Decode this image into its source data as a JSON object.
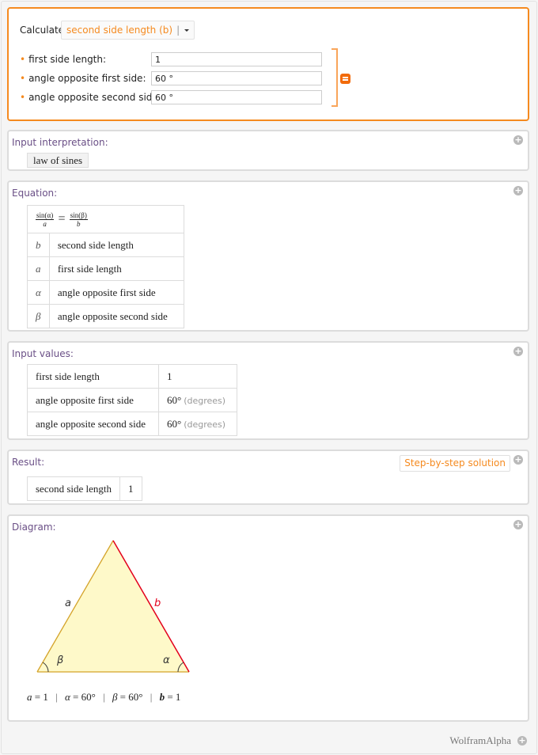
{
  "form": {
    "calculate_label": "Calculate",
    "calculate_value": "second side length (b)",
    "fields": [
      {
        "label": "first side length:",
        "value": "1"
      },
      {
        "label": "angle opposite first side:",
        "value": "60 °"
      },
      {
        "label": "angle opposite second side:",
        "value": "60 °"
      }
    ],
    "accent_color": "#f58a1f"
  },
  "pods": {
    "input_interpretation": {
      "title": "Input interpretation:",
      "value": "law of sines"
    },
    "equation": {
      "title": "Equation:",
      "formula": {
        "left_num": "sin(α)",
        "left_den": "a",
        "eq": "=",
        "right_num": "sin(β)",
        "right_den": "b"
      },
      "rows": [
        {
          "symbol": "b",
          "meaning": "second side length"
        },
        {
          "symbol": "a",
          "meaning": "first side length"
        },
        {
          "symbol": "α",
          "meaning": "angle opposite first side"
        },
        {
          "symbol": "β",
          "meaning": "angle opposite second side"
        }
      ]
    },
    "input_values": {
      "title": "Input values:",
      "rows": [
        {
          "name": "first side length",
          "value": "1",
          "unit": ""
        },
        {
          "name": "angle opposite first side",
          "value": "60°",
          "unit": "(degrees)"
        },
        {
          "name": "angle opposite second side",
          "value": "60°",
          "unit": "(degrees)"
        }
      ]
    },
    "result": {
      "title": "Result:",
      "step_button": "Step-by-step solution",
      "name": "second side length",
      "value": "1"
    },
    "diagram": {
      "title": "Diagram:",
      "labels": {
        "a": "a",
        "b": "b",
        "alpha": "α",
        "beta": "β"
      },
      "caption": [
        {
          "sym": "a",
          "eq": " = ",
          "val": "1"
        },
        {
          "sym": "α",
          "eq": " = ",
          "val": "60°"
        },
        {
          "sym": "β",
          "eq": " = ",
          "val": "60°"
        },
        {
          "sym": "b",
          "eq": " = ",
          "val": "1"
        }
      ],
      "separator": "|",
      "colors": {
        "fill": "#fef9c9",
        "side": "#d4a32a",
        "highlight": "#e3001b"
      }
    }
  },
  "footer": {
    "brand": "WolframAlpha",
    "plus_icon": "+"
  }
}
